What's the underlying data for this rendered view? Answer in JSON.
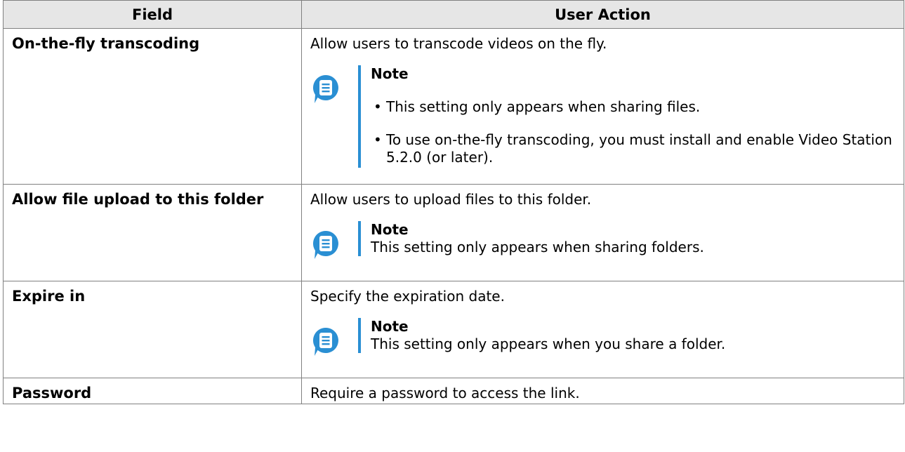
{
  "table": {
    "header": {
      "field": "Field",
      "action": "User Action"
    },
    "rows": [
      {
        "field": "On-the-fly transcoding",
        "action": "Allow users to transcode videos on the fly.",
        "note": {
          "title": "Note",
          "items": [
            "This setting only appears when sharing files.",
            "To use on-the-fly transcoding, you must install and enable Video Station 5.2.0 (or later)."
          ]
        }
      },
      {
        "field": "Allow file upload to this folder",
        "action": "Allow users to upload files to this folder.",
        "note": {
          "title": "Note",
          "text": "This setting only appears when sharing folders."
        }
      },
      {
        "field": "Expire in",
        "action": "Specify the expiration date.",
        "note": {
          "title": "Note",
          "text": "This setting only appears when you share a folder."
        }
      },
      {
        "field": "Password",
        "action": "Require a password to access the link."
      }
    ]
  },
  "colors": {
    "header_bg": "#e6e6e6",
    "border": "#808080",
    "note_accent": "#2a8fd3"
  },
  "icons": {
    "note": "note-speech-bubble-icon"
  }
}
